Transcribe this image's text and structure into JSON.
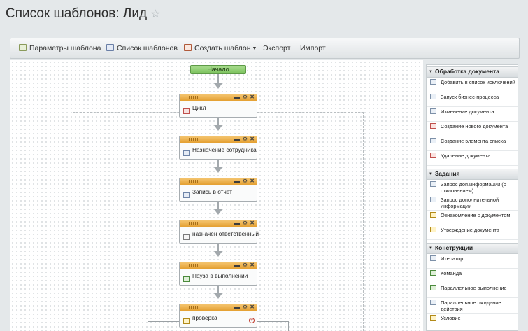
{
  "page": {
    "title": "Список шаблонов: Лид",
    "favorite_icon": "star-icon"
  },
  "toolbar": {
    "params_label": "Параметры шаблона",
    "list_label": "Список шаблонов",
    "create_label": "Создать шаблон",
    "export_label": "Экспорт",
    "import_label": "Импорт"
  },
  "workflow": {
    "start_label": "Начало",
    "activities": [
      {
        "label": "Цикл",
        "icon": "loop-icon"
      },
      {
        "label": "Назначение сотрудника",
        "icon": "assign-icon"
      },
      {
        "label": "Запись в отчет",
        "icon": "report-icon"
      },
      {
        "label": "назначен ответственный",
        "icon": "edit-document-icon"
      },
      {
        "label": "Пауза в выполнении",
        "icon": "pause-icon"
      },
      {
        "label": "проверка",
        "icon": "condition-icon"
      }
    ]
  },
  "palette": {
    "sections": [
      {
        "title": "Обработка документа",
        "items": [
          "Добавить в список исключений",
          "Запуск бизнес-процесса",
          "Изменение документа",
          "Создание нового документа",
          "Создание элемента списка",
          "Удаление документа"
        ]
      },
      {
        "title": "Задания",
        "items": [
          "Запрос доп.информации (с отклонением)",
          "Запрос дополнительной информации",
          "Ознакомление с документом",
          "Утверждение документа"
        ]
      },
      {
        "title": "Конструкции",
        "items": [
          "Итератор",
          "Команда",
          "Параллельное выполнение",
          "Параллельное ожидание действия",
          "Условие"
        ]
      }
    ]
  }
}
